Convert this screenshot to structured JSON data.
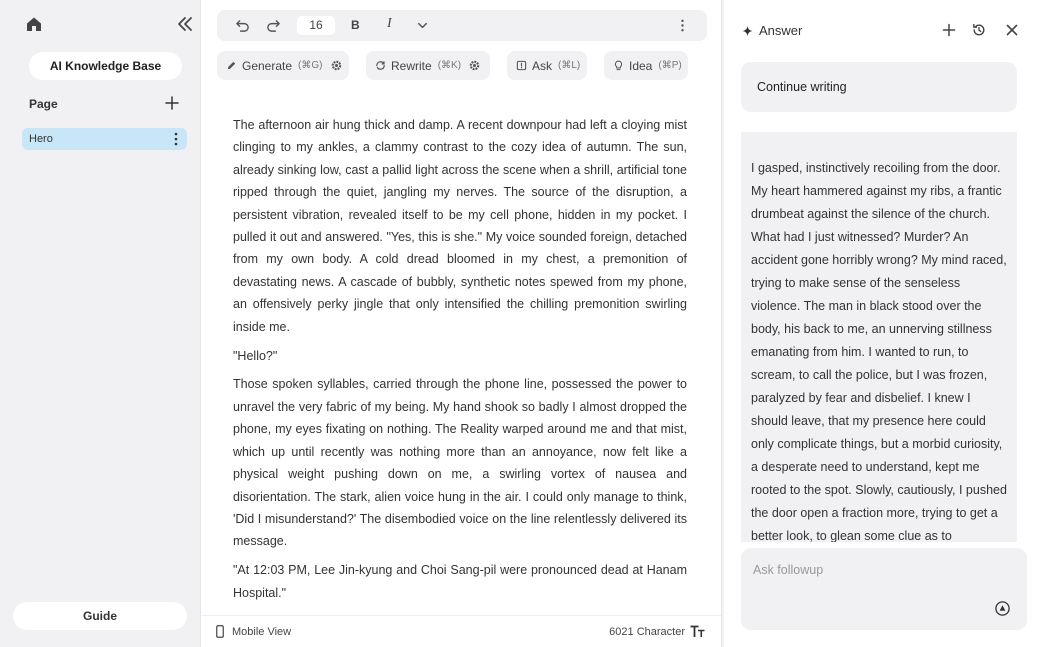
{
  "sidebar": {
    "knowledge_base_label": "AI Knowledge Base",
    "section_label": "Page",
    "pages": [
      {
        "label": "Hero"
      }
    ],
    "guide_label": "Guide"
  },
  "toolbar": {
    "font_size": "16",
    "bold_label": "B",
    "italic_label": "I"
  },
  "actions": {
    "generate": {
      "label": "Generate",
      "shortcut": "(⌘G)"
    },
    "rewrite": {
      "label": "Rewrite",
      "shortcut": "(⌘K)"
    },
    "ask": {
      "label": "Ask",
      "shortcut": "(⌘L)"
    },
    "idea": {
      "label": "Idea",
      "shortcut": "(⌘P)"
    }
  },
  "document": {
    "paragraphs": [
      "The afternoon air hung thick and damp. A recent downpour had left a cloying mist clinging to my ankles, a clammy contrast to the cozy idea of autumn. The sun, already sinking low, cast a pallid light across the scene when a shrill, artificial tone ripped through the quiet, jangling my nerves. The source of the disruption, a persistent vibration, revealed itself to be my cell phone, hidden in my pocket. I pulled it out and answered. \"Yes, this is she.\" My voice sounded foreign, detached from my own body. A cold dread bloomed in my chest, a premonition of devastating news. A cascade of bubbly, synthetic notes spewed from my phone, an offensively perky jingle that only intensified the chilling premonition swirling inside me.",
      "\"Hello?\"",
      "Those spoken syllables, carried through the phone line, possessed the power to unravel the very fabric of my being. My hand shook so badly I almost dropped the phone, my eyes fixating on nothing. The Reality warped around me and that mist, which up until recently was nothing more than an annoyance, now felt like a physical weight pushing down on me, a swirling vortex of nausea and disorientation. The stark, alien voice hung in the air. I could only manage to think, 'Did I misunderstand?' The disembodied voice on the line relentlessly delivered its message.",
      "\"At 12:03 PM, Lee Jin-kyung and Choi Sang-pil were pronounced dead at Hanam Hospital.\""
    ]
  },
  "footer": {
    "mobile_view_label": "Mobile View",
    "character_count": "6021 Character"
  },
  "answer_panel": {
    "title": "Answer",
    "continue_label": "Continue writing",
    "answer_text": "I gasped, instinctively recoiling from the door. My heart hammered against my ribs, a frantic drumbeat against the silence of the church. What had I just witnessed? Murder? An accident gone horribly wrong? My mind raced, trying to make sense of the senseless violence. The man in black stood over the body, his back to me, an unnerving stillness emanating from him. I wanted to run, to scream, to call the police, but I was frozen, paralyzed by fear and disbelief. I knew I should leave, that my presence here could only complicate things, but a morbid curiosity, a desperate need to understand, kept me rooted to the spot. Slowly, cautiously, I pushed the door open a fraction more, trying to get a better look, to glean some clue as to",
    "followup_placeholder": "Ask followup"
  }
}
